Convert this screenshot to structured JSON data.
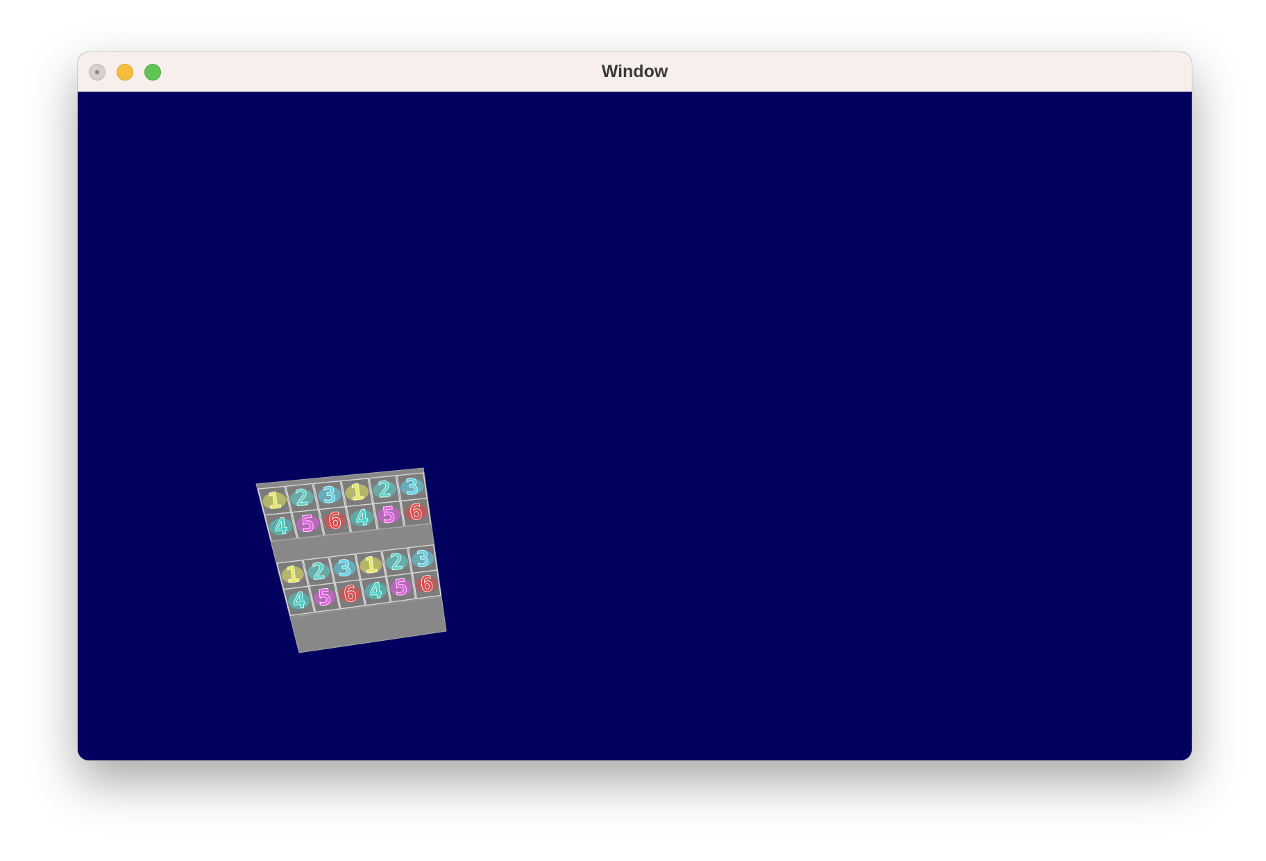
{
  "window": {
    "title": "Window"
  },
  "viewport": {
    "background": "#01005f"
  },
  "texture": {
    "background": "#888888",
    "grid_line": "#d8d8d8",
    "rows": [
      [
        "1",
        "2",
        "3",
        "1",
        "2",
        "3"
      ],
      [
        "4",
        "5",
        "6",
        "4",
        "5",
        "6"
      ],
      [
        "1",
        "2",
        "3",
        "1",
        "2",
        "3"
      ],
      [
        "4",
        "5",
        "6",
        "4",
        "5",
        "6"
      ]
    ],
    "digit_colors": {
      "1": "#e6e65a",
      "2": "#5ad2c8",
      "3": "#5ad2e6",
      "4": "#46d2c8",
      "5": "#e65ae6",
      "6": "#e64646"
    }
  }
}
